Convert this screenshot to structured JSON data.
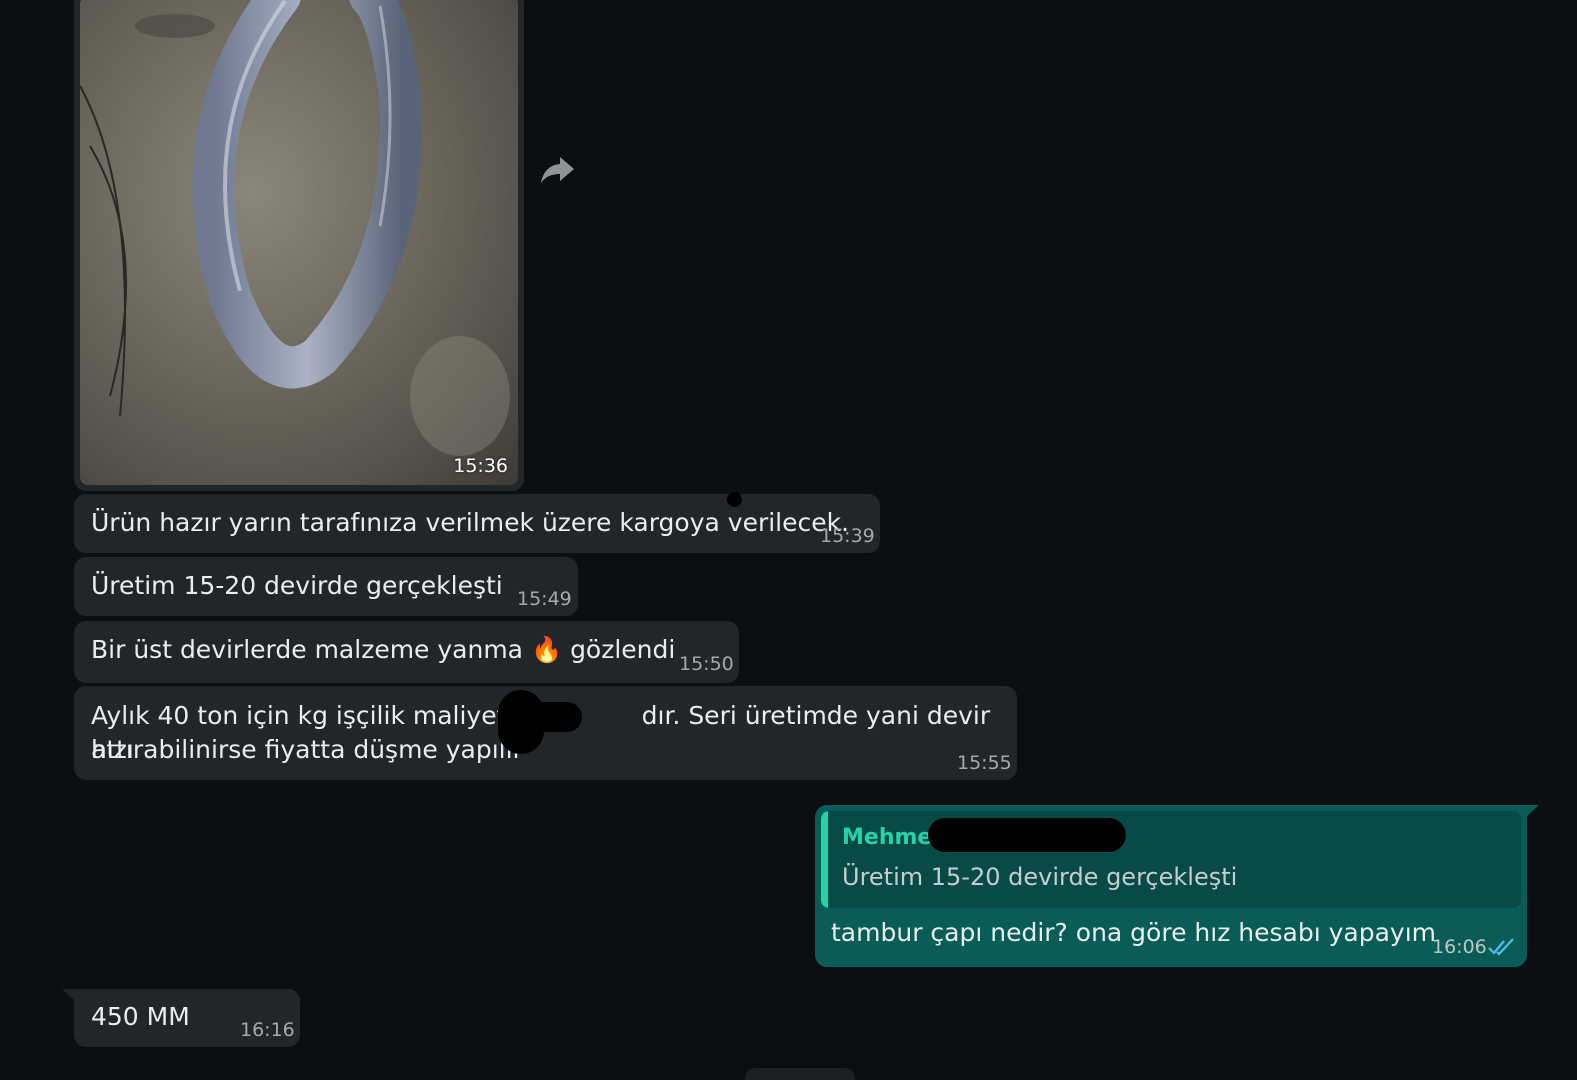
{
  "messages": [
    {
      "type": "image",
      "time": "15:36"
    },
    {
      "text": "Ürün hazır yarın tarafınıza verilmek üzere kargoya verilecek.",
      "time": "15:39"
    },
    {
      "text": "Üretim 15-20 devirde gerçekleşti",
      "time": "15:49"
    },
    {
      "text_before": "Bir üst devirlerde malzeme yanma",
      "emoji": "🔥",
      "text_after": "gözlendi",
      "time": "15:50"
    },
    {
      "line1_before": "Aylık 40 ton için kg işçilik maliyetim",
      "line1_after": "dır. Seri üretimde yani devir hızı",
      "line2": "attırabilinirse fiyatta düşme yapılır",
      "time": "15:55"
    },
    {
      "type": "outgoing",
      "quote_name": "Mehmet",
      "quote_text": "Üretim 15-20 devirde gerçekleşti",
      "text": "tambur çapı nedir? ona göre hız hesabı yapayım",
      "time": "16:06",
      "status": "read"
    },
    {
      "text": "450 MM",
      "time": "16:16"
    }
  ],
  "icons": {
    "forward": "forward-icon",
    "read_receipt": "double-check-icon",
    "emoji": "fire-emoji"
  },
  "colors": {
    "background": "#0b0f12",
    "incoming_bubble": "#232629",
    "outgoing_bubble": "#0a5c56",
    "quote_accent": "#25d3a6",
    "read_tick": "#53bdeb"
  }
}
